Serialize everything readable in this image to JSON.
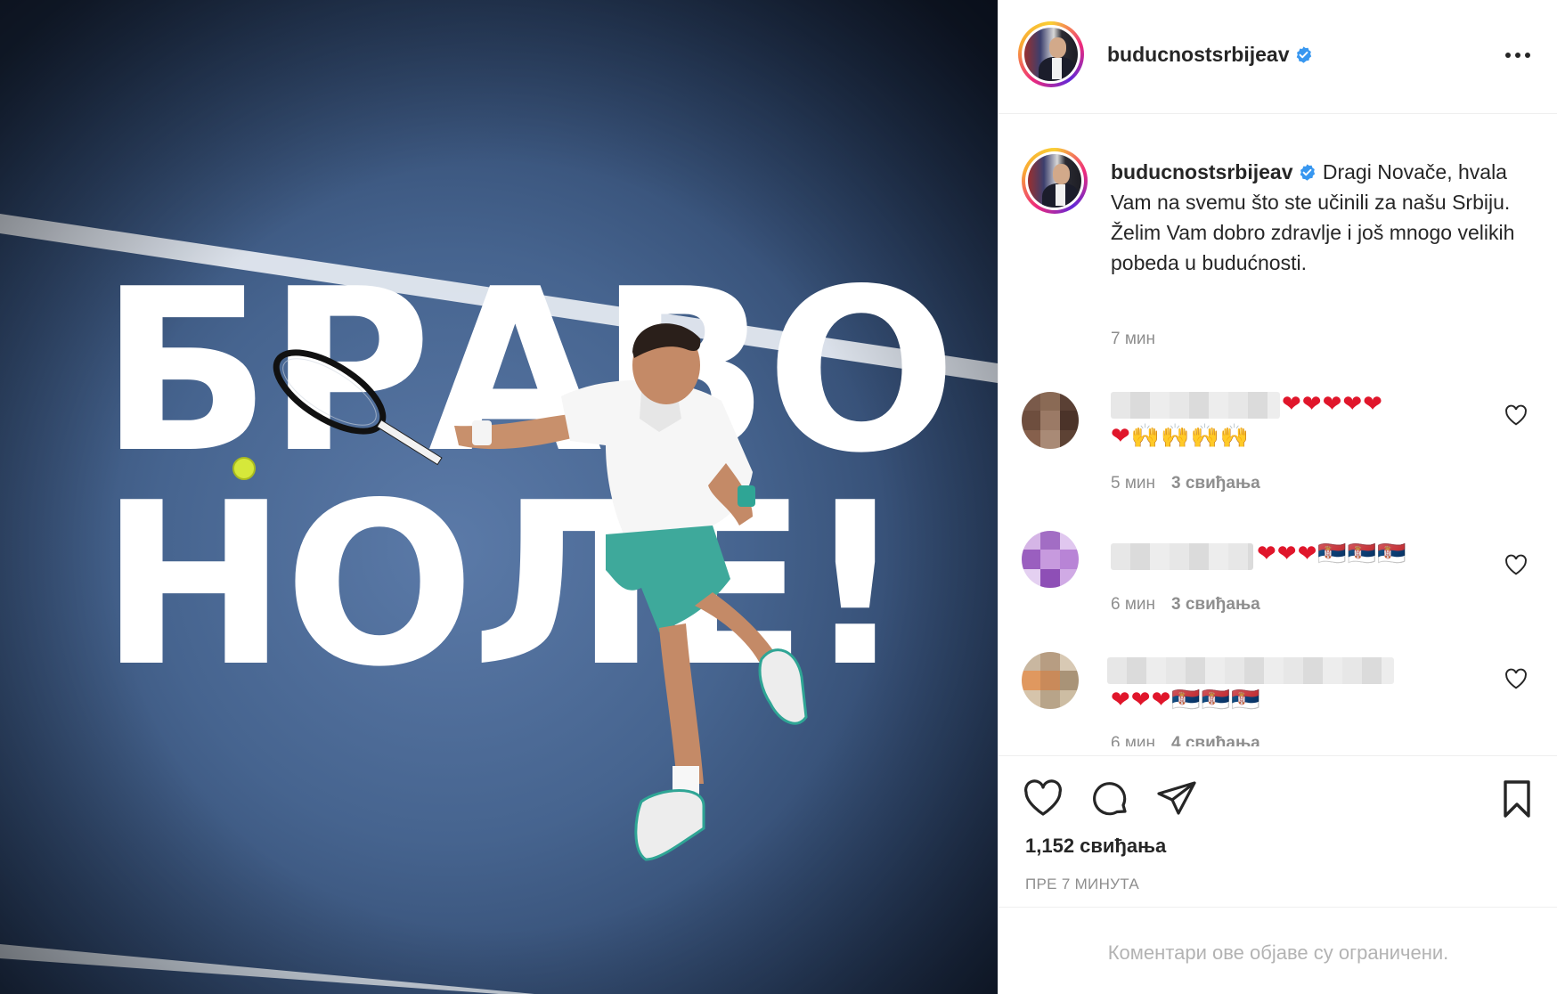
{
  "post": {
    "image": {
      "headline_line1": "БРАВО",
      "headline_line2": "НОЛЕ!",
      "background_color": "#4a6b97"
    },
    "header": {
      "username": "buducnostsrbijeav",
      "verified": true,
      "more_icon": "more-horizontal-icon"
    },
    "caption": {
      "username": "buducnostsrbijeav",
      "text": "Dragi Novače, hvala Vam na svemu što ste učinili za našu Srbiju. Želim Vam dobro zdravlje i još mnogo velikih pobeda u budućnosti.",
      "time": "7 мин"
    },
    "comments": [
      {
        "emojis": "❤❤❤❤❤",
        "emojis2": "❤🙌🙌🙌🙌",
        "time": "5 мин",
        "likes": "3 свиђања"
      },
      {
        "emojis": "❤❤❤🇷🇸🇷🇸🇷🇸",
        "time": "6 мин",
        "likes": "3 свиђања"
      },
      {
        "emojis": "❤❤❤🇷🇸🇷🇸🇷🇸",
        "time": "6 мин",
        "likes": "4 свиђања"
      }
    ],
    "actions": {
      "like_icon": "heart-icon",
      "comment_icon": "comment-icon",
      "share_icon": "paper-plane-icon",
      "save_icon": "bookmark-icon"
    },
    "likes": "1,152 свиђања",
    "posted": "ПРЕ 7 МИНУТА",
    "comments_note": "Коментари ове објаве су ограничени.",
    "colors": {
      "verified": "#3897f0",
      "text": "#262626",
      "muted": "#8e8e8e",
      "divider": "#efefef"
    }
  }
}
